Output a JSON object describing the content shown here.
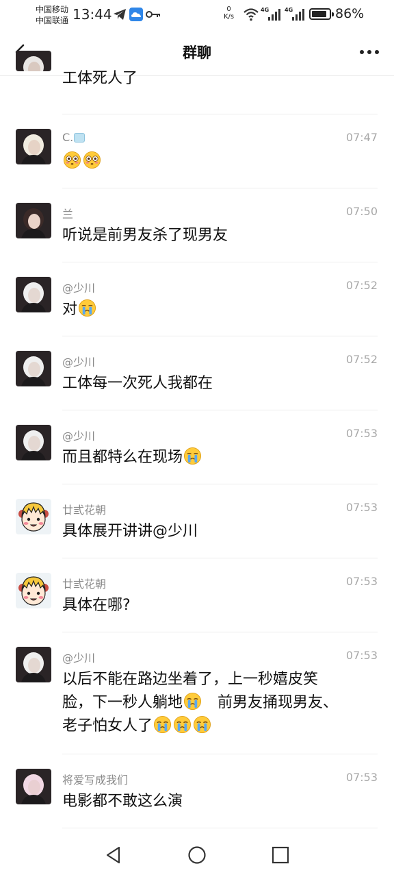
{
  "status_bar": {
    "carrier1": "中国移动",
    "carrier2": "中国联通",
    "time": "13:44",
    "speed_value": "0",
    "speed_unit": "K/s",
    "net_type1": "4G",
    "net_type2": "4G",
    "battery_level": 0.86,
    "battery_percent": "86%",
    "icons": [
      "telegram-icon",
      "cloud-app-icon",
      "key-icon",
      "wifi-icon",
      "signal-icon",
      "battery-icon"
    ]
  },
  "header": {
    "title": "群聊",
    "back_icon": "chevron-left-icon",
    "more_icon": "more-horizontal-icon"
  },
  "messages": [
    {
      "sender": "",
      "time": "",
      "lines": [
        [
          {
            "t": "工体死人了"
          }
        ]
      ]
    },
    {
      "sender": "C.",
      "time": "07:47",
      "lines": [
        [
          {
            "e": "flushed"
          },
          {
            "e": "flushed"
          }
        ]
      ]
    },
    {
      "sender": "兰",
      "time": "07:50",
      "lines": [
        [
          {
            "t": "听说是前男友杀了现男友"
          }
        ]
      ]
    },
    {
      "sender": "@少川",
      "time": "07:52",
      "lines": [
        [
          {
            "t": "对"
          },
          {
            "e": "cry"
          }
        ]
      ]
    },
    {
      "sender": "@少川",
      "time": "07:52",
      "lines": [
        [
          {
            "t": "工体每一次死人我都在"
          }
        ]
      ]
    },
    {
      "sender": "@少川",
      "time": "07:53",
      "lines": [
        [
          {
            "t": "而且都特么在现场"
          },
          {
            "e": "cry"
          }
        ]
      ]
    },
    {
      "sender": "廿弎花朝",
      "time": "07:53",
      "lines": [
        [
          {
            "t": "具体展开讲讲@少川"
          }
        ]
      ]
    },
    {
      "sender": "廿弎花朝",
      "time": "07:53",
      "lines": [
        [
          {
            "t": "具体在哪?"
          }
        ]
      ]
    },
    {
      "sender": "@少川",
      "time": "07:53",
      "lines": [
        [
          {
            "t": "以后不能在路边坐着了，上一秒嬉皮笑"
          }
        ],
        [
          {
            "t": "脸，下一秒人躺地"
          },
          {
            "e": "cry"
          },
          {
            "t": "　前男友捅现男友、"
          }
        ],
        [
          {
            "t": "老子怕女人了"
          },
          {
            "e": "cry"
          },
          {
            "e": "cry"
          },
          {
            "e": "cry"
          }
        ]
      ]
    },
    {
      "sender": "将爱写成我们",
      "time": "07:53",
      "lines": [
        [
          {
            "t": "电影都不敢这么演"
          }
        ]
      ]
    }
  ],
  "nav": {
    "back": "triangle-back-icon",
    "home": "circle-home-icon",
    "recents": "square-recents-icon"
  }
}
